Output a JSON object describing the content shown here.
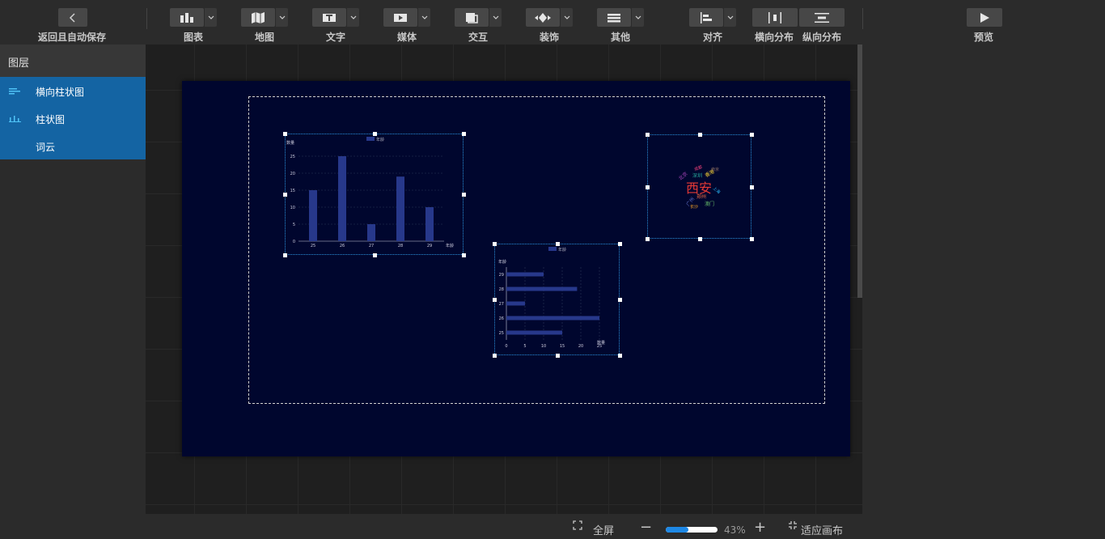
{
  "toolbar": {
    "back_label": "返回且自动保存",
    "chart_label": "图表",
    "map_label": "地图",
    "text_label": "文字",
    "media_label": "媒体",
    "interact_label": "交互",
    "decor_label": "装饰",
    "other_label": "其他",
    "align_label": "对齐",
    "h_distribute_label": "横向分布",
    "v_distribute_label": "纵向分布",
    "preview_label": "预览"
  },
  "layers": {
    "title": "图层",
    "items": [
      {
        "label": "横向柱状图",
        "icon": "horizontal-bar-icon"
      },
      {
        "label": "柱状图",
        "icon": "bar-chart-icon"
      },
      {
        "label": "词云",
        "icon": ""
      }
    ]
  },
  "bar_chart": {
    "legend": "年龄",
    "ylabel": "数量",
    "xlabel": "年龄",
    "ticks_y": [
      "0",
      "5",
      "10",
      "15",
      "20",
      "25"
    ],
    "chart_data": {
      "type": "bar",
      "categories": [
        "25",
        "26",
        "27",
        "28",
        "29"
      ],
      "values": [
        15,
        25,
        5,
        19,
        10
      ],
      "ylim": [
        0,
        25
      ]
    }
  },
  "hbar_chart": {
    "legend": "年龄",
    "ylabel": "年龄",
    "xlabel": "数量",
    "ticks_x": [
      "0",
      "5",
      "10",
      "15",
      "20",
      "25"
    ],
    "chart_data": {
      "type": "bar",
      "orientation": "horizontal",
      "categories": [
        "29",
        "28",
        "27",
        "26",
        "25"
      ],
      "values": [
        10,
        19,
        5,
        25,
        15
      ],
      "xlim": [
        0,
        25
      ]
    }
  },
  "word_cloud": {
    "words": [
      {
        "text": "西安",
        "color": "#e53935",
        "size": "large"
      },
      {
        "text": "深圳",
        "color": "#26a69a",
        "size": "small"
      },
      {
        "text": "香港",
        "color": "#fdd835",
        "size": "small"
      },
      {
        "text": "郑州",
        "color": "#ff7043",
        "size": "small"
      },
      {
        "text": "澳门",
        "color": "#66bb6a",
        "size": "small"
      },
      {
        "text": "北京",
        "color": "#ab47bc",
        "size": "small"
      },
      {
        "text": "广州",
        "color": "#5c6bc0",
        "size": "small"
      },
      {
        "text": "上海",
        "color": "#29b6f6",
        "size": "small"
      },
      {
        "text": "成都",
        "color": "#ec407a",
        "size": "small"
      },
      {
        "text": "南京",
        "color": "#8d6e63",
        "size": "small"
      },
      {
        "text": "长沙",
        "color": "#ffa726",
        "size": "small"
      }
    ]
  },
  "bottombar": {
    "fullscreen_label": "全屏",
    "zoom_value": "43%",
    "zoom_fraction": 0.43,
    "fit_label": "适应画布"
  },
  "colors": {
    "accent": "#1464a3",
    "screen_bg": "#00062e",
    "bar_color": "#27388b"
  }
}
